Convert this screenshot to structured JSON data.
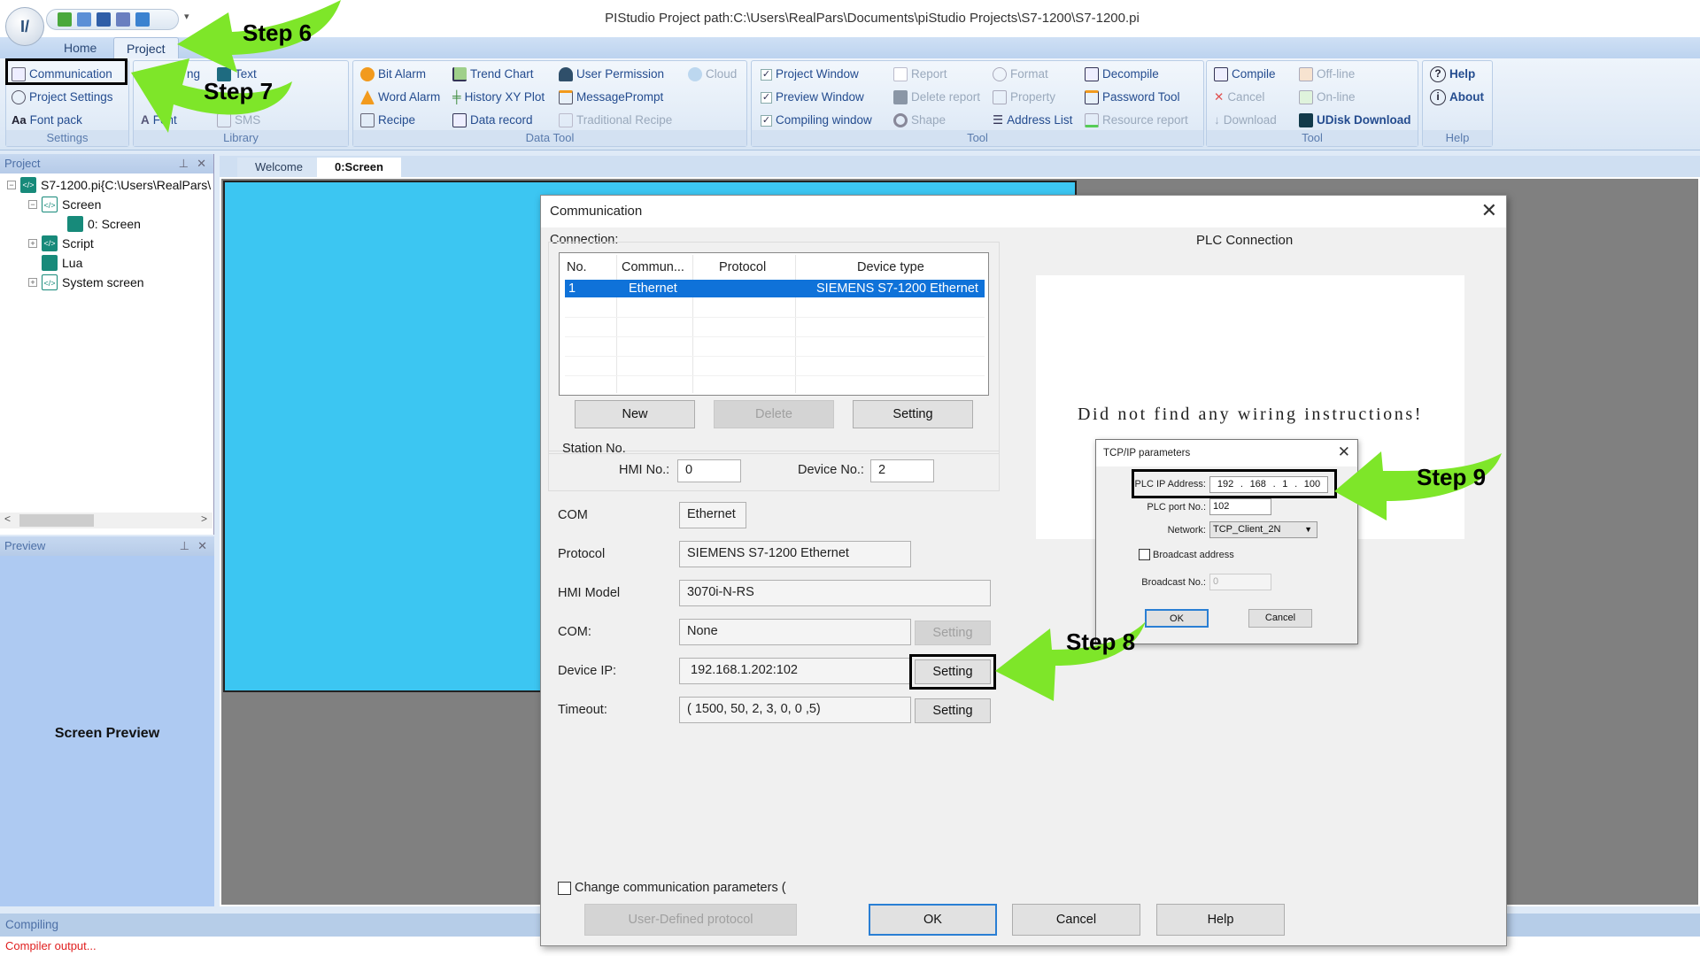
{
  "window": {
    "title": "PIStudio   Project path:C:\\Users\\RealPars\\Documents\\piStudio Projects\\S7-1200\\S7-1200.pi",
    "logo": "pi-logo"
  },
  "ribbon": {
    "tabs": [
      {
        "label": "Home"
      },
      {
        "label": "Project",
        "active": true
      }
    ],
    "groups": {
      "settings": {
        "label": "Settings",
        "items": [
          "Communication",
          "Project Settings",
          "Font pack"
        ]
      },
      "library": {
        "label": "Library",
        "items": [
          "ng",
          "Text",
          "Font",
          "SMS"
        ]
      },
      "data_tool": {
        "label": "Data Tool",
        "items": [
          "Bit Alarm",
          "Word Alarm",
          "Recipe",
          "Trend Chart",
          "History XY Plot",
          "Data record",
          "User Permission",
          "MessagePrompt",
          "Traditional Recipe",
          "Cloud"
        ]
      },
      "tool1": {
        "label": "Tool",
        "items": [
          "Project Window",
          "Preview Window",
          "Compiling window",
          "Report",
          "Delete report",
          "Shape",
          "Format",
          "Property",
          "Address List",
          "Decompile",
          "Password Tool",
          "Resource report"
        ]
      },
      "tool2": {
        "label": "Tool",
        "items": [
          "Compile",
          "Cancel",
          "Download",
          "Off-line",
          "On-line",
          "UDisk Download"
        ]
      },
      "help": {
        "label": "Help",
        "items": [
          "Help",
          "About"
        ]
      }
    }
  },
  "project_panel": {
    "title": "Project",
    "tree": [
      {
        "label": "S7-1200.pi{C:\\Users\\RealPars\\",
        "level": 0,
        "toggle": "-"
      },
      {
        "label": "Screen",
        "level": 1,
        "toggle": "-"
      },
      {
        "label": "0: Screen",
        "level": 2,
        "toggle": ""
      },
      {
        "label": "Script",
        "level": 1,
        "toggle": "+"
      },
      {
        "label": "Lua",
        "level": 1,
        "toggle": ""
      },
      {
        "label": "System screen",
        "level": 1,
        "toggle": "+"
      }
    ]
  },
  "preview_panel": {
    "title": "Preview",
    "label": "Screen Preview"
  },
  "doc_tabs": [
    {
      "label": "Welcome"
    },
    {
      "label": "0:Screen",
      "active": true
    }
  ],
  "compiling": {
    "title": "Compiling",
    "output": "Compiler output..."
  },
  "communication_dialog": {
    "title": "Communication",
    "connection_label": "Connection:",
    "table": {
      "columns": [
        "No.",
        "Commun...",
        "Protocol",
        "Device type"
      ],
      "rows": [
        {
          "no": "1",
          "commun": "Ethernet",
          "protocol": "",
          "device_type": "SIEMENS S7-1200 Ethernet",
          "selected": true
        }
      ]
    },
    "buttons": {
      "new": "New",
      "delete": "Delete",
      "setting": "Setting"
    },
    "station": {
      "label": "Station No.",
      "hmi_no_label": "HMI No.:",
      "hmi_no": "0",
      "device_no_label": "Device No.:",
      "device_no": "2"
    },
    "fields": {
      "com_label": "COM",
      "com": "Ethernet",
      "protocol_label": "Protocol",
      "protocol": "SIEMENS S7-1200 Ethernet",
      "hmi_model_label": "HMI Model",
      "hmi_model": "3070i-N-RS",
      "com2_label": "COM:",
      "com2": "None",
      "com2_setting": "Setting",
      "device_ip_label": "Device IP:",
      "device_ip": "192.168.1.202:102",
      "device_ip_setting": "Setting",
      "timeout_label": "Timeout:",
      "timeout": "( 1500, 50, 2, 3, 0, 0 ,5)",
      "timeout_setting": "Setting"
    },
    "plc_connection": {
      "title": "PLC Connection",
      "message": "Did not find any wiring instructions!"
    },
    "change_params_label": "Change communication parameters (",
    "change_params_checked": false,
    "footer": {
      "user_defined": "User-Defined protocol",
      "ok": "OK",
      "cancel": "Cancel",
      "help": "Help"
    }
  },
  "tcp_dialog": {
    "title": "TCP/IP parameters",
    "plc_ip_label": "PLC IP Address:",
    "plc_ip": [
      "192",
      "168",
      "1",
      "100"
    ],
    "port_label": "PLC port No.:",
    "port": "102",
    "network_label": "Network:",
    "network": "TCP_Client_2N",
    "broadcast_label": "Broadcast address",
    "broadcast_checked": false,
    "broadcast_no_label": "Broadcast No.:",
    "broadcast_no": "0",
    "ok": "OK",
    "cancel": "Cancel"
  },
  "annotations": {
    "step6": "Step 6",
    "step7": "Step 7",
    "step8": "Step 8",
    "step9": "Step 9",
    "arrow_color": "#7ee629"
  }
}
